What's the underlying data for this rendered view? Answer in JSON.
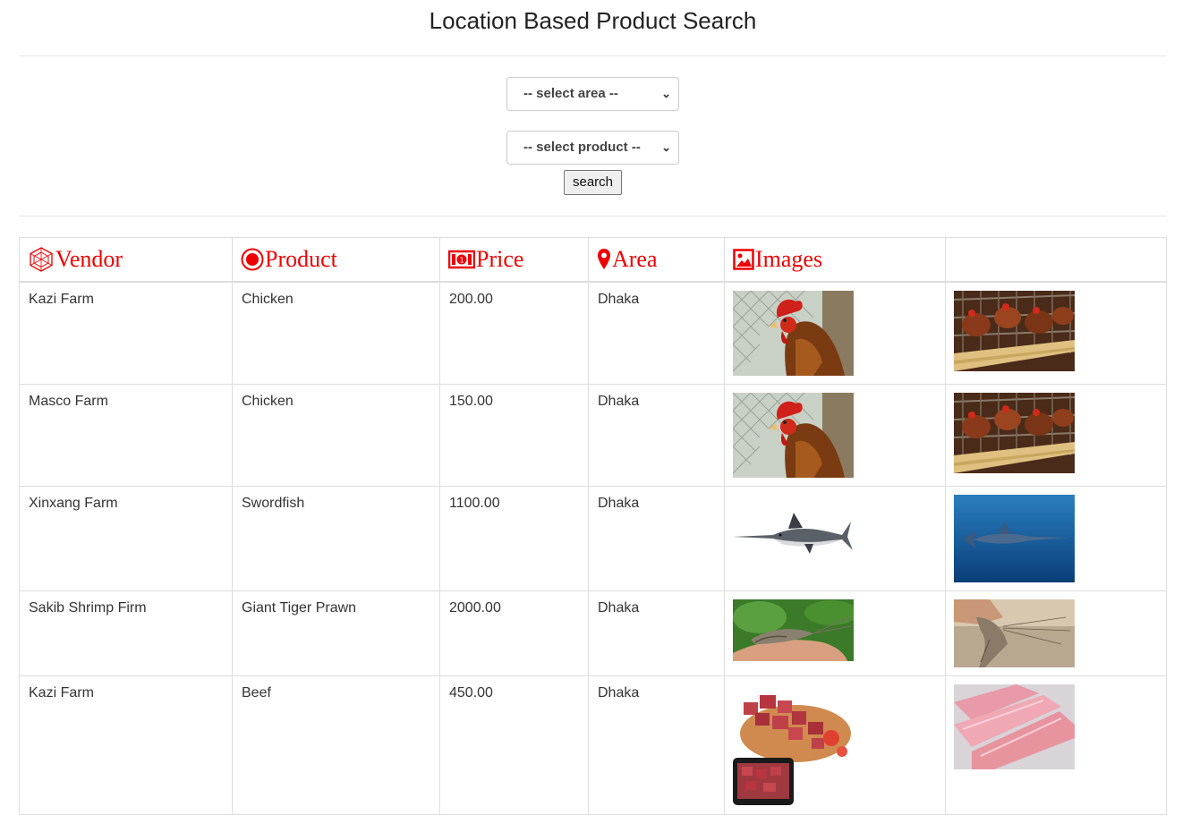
{
  "title": "Location Based Product Search",
  "form": {
    "area_select": "-- select area --",
    "product_select": "-- select product --",
    "search_button": "search"
  },
  "table": {
    "headers": [
      "Vendor",
      "Product",
      "Price",
      "Area",
      "Images",
      ""
    ],
    "rows": [
      {
        "vendor": "Kazi Farm",
        "product": "Chicken",
        "price": "200.00",
        "area": "Dhaka",
        "images": [
          "rooster-photo",
          "caged-hens-photo"
        ]
      },
      {
        "vendor": "Masco Farm",
        "product": "Chicken",
        "price": "150.00",
        "area": "Dhaka",
        "images": [
          "rooster-photo",
          "caged-hens-photo"
        ]
      },
      {
        "vendor": "Xinxang Farm",
        "product": "Swordfish",
        "price": "1100.00",
        "area": "Dhaka",
        "images": [
          "swordfish-photo",
          "swordfish-underwater-photo"
        ]
      },
      {
        "vendor": "Sakib Shrimp Firm",
        "product": "Giant Tiger Prawn",
        "price": "2000.00",
        "area": "Dhaka",
        "images": [
          "prawn-in-hand-photo",
          "prawn-held-photo"
        ]
      },
      {
        "vendor": "Kazi Farm",
        "product": "Beef",
        "price": "450.00",
        "area": "Dhaka",
        "images": [
          "beef-cubes-photo",
          "beef-slabs-photo"
        ]
      }
    ]
  },
  "colors": {
    "header_red": "#e00000",
    "border": "#dddddd"
  }
}
